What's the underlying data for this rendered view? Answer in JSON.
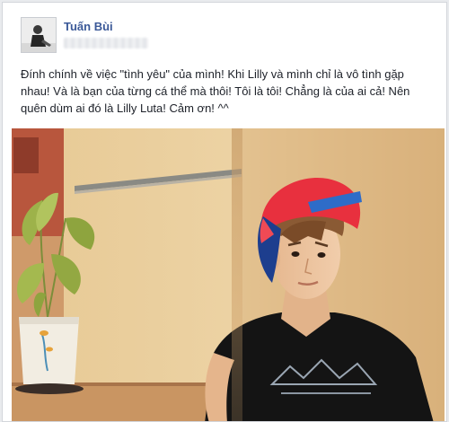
{
  "post": {
    "author_name": "Tuấn Bùi",
    "message": "Đính chính về việc \"tình yêu\" của mình! Khi Lilly và mình chỉ là vô tình gặp nhau! Và là bạn của từng cá thể mà thôi! Tôi là tôi! Chẳng là của ai cả! Nên quên dùm ai đó là Lilly Luta! Cảm ơn! ^^"
  },
  "colors": {
    "author_link": "#3b5998",
    "text": "#1d2129",
    "page_background": "#e9ebee"
  }
}
